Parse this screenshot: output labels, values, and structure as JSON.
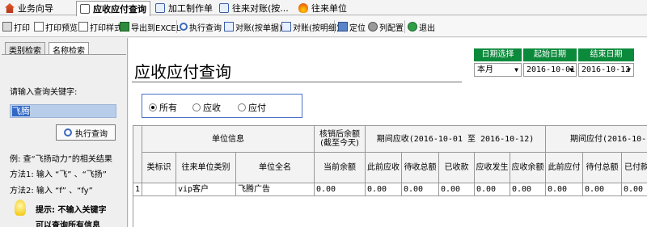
{
  "tabs": [
    {
      "label": "业务向导",
      "active": false
    },
    {
      "label": "应收应付查询",
      "active": true
    },
    {
      "label": "加工制作单",
      "active": false
    },
    {
      "label": "往来对账(按...",
      "active": false
    },
    {
      "label": "往来单位",
      "active": false
    }
  ],
  "toolbar": {
    "print": "打印",
    "print_preview": "打印预览",
    "print_style": "打印样式",
    "export_excel": "导出到EXCEL",
    "run_query": "执行查询",
    "reconcile_unit": "对账(按单据)",
    "reconcile_detail": "对账(按明细)",
    "locate": "定位",
    "column_config": "列配置",
    "exit": "退出"
  },
  "left": {
    "tab_category": "类别检索",
    "tab_name": "名称检索",
    "prompt": "请输入查询关键字:",
    "keyword": "飞腾",
    "query_button": "执行查询",
    "example": "例: 查“飞扬动力”的相关结果",
    "method1": "方法1: 输入 “飞” 、“飞扬”",
    "method2": "方法2: 输入 “f” 、“fy”",
    "hint1": "提示: 不输入关键字",
    "hint2": "可以查询所有信息"
  },
  "main": {
    "title": "应收应付查询",
    "date_select_label": "日期选择",
    "start_date_label": "起始日期",
    "end_date_label": "结束日期",
    "date_select_value": "本月",
    "start_date_value": "2016-10-01",
    "end_date_value": "2016-10-12",
    "radio": {
      "all": "所有",
      "receivable": "应收",
      "payable": "应付",
      "selected": "all"
    }
  },
  "table": {
    "group_unit_info": "单位信息",
    "group_balance_line1": "核销后余额",
    "group_balance_line2": "(截至今天)",
    "group_period_receivable": "期间应收(2016-10-01 至 2016-10-12)",
    "group_period_payable": "期间应付(2016-10-",
    "headers": [
      "类标识",
      "往来单位类别",
      "单位全名",
      "当前余额",
      "此前应收",
      "待收总额",
      "已收款",
      "应收发生",
      "应收余额",
      "此前应付",
      "待付总额",
      "已付款"
    ],
    "rows": [
      {
        "index": "1",
        "type_id": "",
        "unit_category": "vip客户",
        "unit_name": "飞腾广告",
        "current_balance": "0.00",
        "prev_receivable": "0.00",
        "pending_receivable": "0.00",
        "received": "0.00",
        "receivable_incurred": "0.00",
        "receivable_balance": "0.00",
        "prev_payable": "0.00",
        "pending_payable": "0.00",
        "paid": "0.00"
      }
    ]
  },
  "colors": {
    "date_header_bg": "#0c8a3c",
    "radio_border": "#4a70c8",
    "keyword_highlight": "#3168c6"
  }
}
